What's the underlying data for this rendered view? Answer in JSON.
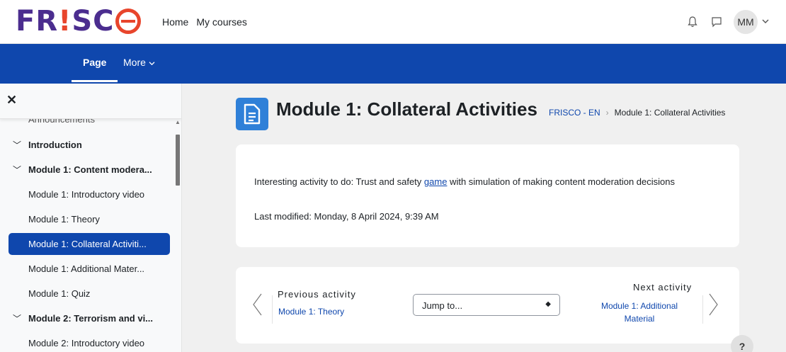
{
  "brand": {
    "logo_text": "FRISCO"
  },
  "topnav": {
    "items": [
      {
        "label": "Home"
      },
      {
        "label": "My courses"
      }
    ]
  },
  "user": {
    "initials": "MM"
  },
  "icons": {
    "notifications": "bell-icon",
    "messages": "chat-icon",
    "user_menu": "chevron-down-icon",
    "close": "close-icon",
    "page": "page-document-icon"
  },
  "secnav": {
    "page_label": "Page",
    "more_label": "More"
  },
  "drawer": {
    "partial_item": "Announcements",
    "items": [
      {
        "label": "Introduction",
        "type": "section"
      },
      {
        "label": "Module 1: Content modera...",
        "type": "section"
      },
      {
        "label": "Module 1: Introductory video",
        "type": "activity"
      },
      {
        "label": "Module 1: Theory",
        "type": "activity"
      },
      {
        "label": "Module 1: Collateral Activiti...",
        "type": "activity",
        "active": true
      },
      {
        "label": "Module 1: Additional Mater...",
        "type": "activity"
      },
      {
        "label": "Module 1: Quiz",
        "type": "activity"
      },
      {
        "label": "Module 2: Terrorism and vi...",
        "type": "section"
      },
      {
        "label": "Module 2: Introductory video",
        "type": "activity"
      }
    ]
  },
  "page": {
    "title": "Module 1: Collateral Activities",
    "breadcrumb": [
      "FRISCO - EN",
      "Module 1: Collateral Activities"
    ]
  },
  "content": {
    "desc_before": "Interesting activity to do: Trust and safety ",
    "desc_link": "game",
    "desc_after": " with simulation of making content moderation decisions",
    "last_modified": "Last modified: Monday, 8 April 2024, 9:39 AM"
  },
  "activity_nav": {
    "prev_label": "Previous activity",
    "prev_link": "Module 1: Theory",
    "jump_placeholder": "Jump to...",
    "next_label": "Next activity",
    "next_link": "Module 1: Additional Material"
  },
  "help": {
    "label": "?"
  },
  "colors": {
    "brand_blue": "#0f47ad",
    "logo_purple": "#4b2d8f",
    "logo_red": "#e8452c",
    "page_icon": "#2f80d8"
  }
}
